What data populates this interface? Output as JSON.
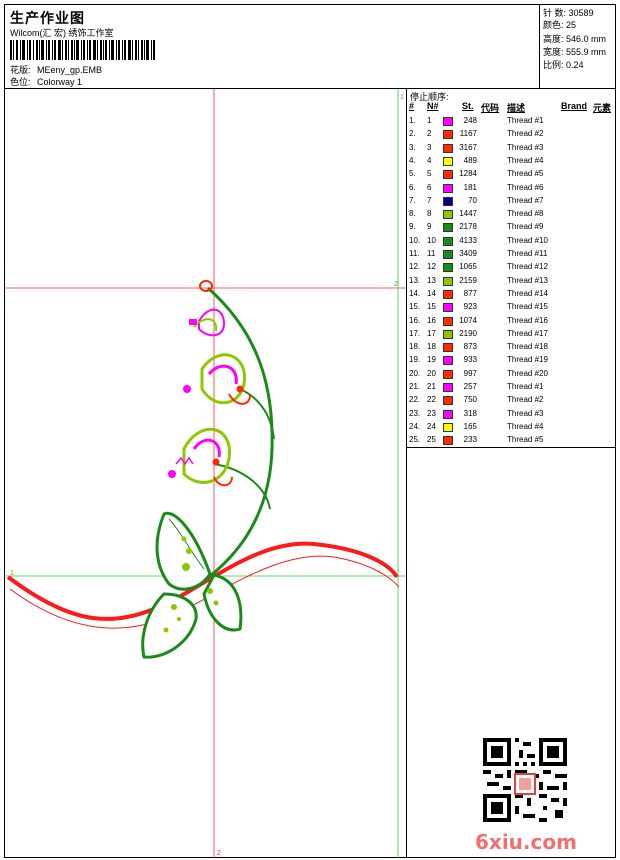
{
  "header": {
    "title": "生产作业图",
    "subtitle": "Wilcom(汇 宏) 绣饰工作室",
    "design_label": "花版:",
    "design_value": "MEeny_gp.EMB",
    "colorway_label": "色位:",
    "colorway_value": "Colorway 1"
  },
  "stats": [
    {
      "label": "针 数:",
      "value": "30589"
    },
    {
      "label": "颜色:",
      "value": "25"
    },
    {
      "label": "高度:",
      "value": "546.0 mm"
    },
    {
      "label": "宽度:",
      "value": "555.9 mm"
    },
    {
      "label": "比例:",
      "value": "0.24"
    }
  ],
  "canvas_marks": {
    "top_right": "1",
    "left_mid": "1",
    "red_right": "2",
    "bottom": "2"
  },
  "stops": {
    "title": "停止顺序:",
    "headers": {
      "num": "#",
      "n": "N#",
      "st": "St.",
      "code": "代码",
      "desc": "描述",
      "brand": "Brand",
      "elements": "元素"
    },
    "rows": [
      {
        "i": "1.",
        "n": "1",
        "st": "248",
        "color": "#ff00ff",
        "desc": "Thread #1"
      },
      {
        "i": "2.",
        "n": "2",
        "st": "1167",
        "color": "#ff2a00",
        "desc": "Thread #2"
      },
      {
        "i": "3.",
        "n": "3",
        "st": "3167",
        "color": "#ff2a00",
        "desc": "Thread #3"
      },
      {
        "i": "4.",
        "n": "4",
        "st": "489",
        "color": "#ffff00",
        "desc": "Thread #4"
      },
      {
        "i": "5.",
        "n": "5",
        "st": "1284",
        "color": "#ff2a00",
        "desc": "Thread #5"
      },
      {
        "i": "6.",
        "n": "6",
        "st": "181",
        "color": "#ff00ff",
        "desc": "Thread #6"
      },
      {
        "i": "7.",
        "n": "7",
        "st": "70",
        "color": "#000080",
        "desc": "Thread #7"
      },
      {
        "i": "8.",
        "n": "8",
        "st": "1447",
        "color": "#8cc800",
        "desc": "Thread #8"
      },
      {
        "i": "9.",
        "n": "9",
        "st": "2178",
        "color": "#1a8a1a",
        "desc": "Thread #9"
      },
      {
        "i": "10.",
        "n": "10",
        "st": "4133",
        "color": "#1a8a1a",
        "desc": "Thread #10"
      },
      {
        "i": "11.",
        "n": "11",
        "st": "3409",
        "color": "#1a8a1a",
        "desc": "Thread #11"
      },
      {
        "i": "12.",
        "n": "12",
        "st": "1065",
        "color": "#1a8a1a",
        "desc": "Thread #12"
      },
      {
        "i": "13.",
        "n": "13",
        "st": "2159",
        "color": "#8cc800",
        "desc": "Thread #13"
      },
      {
        "i": "14.",
        "n": "14",
        "st": "877",
        "color": "#ff2a00",
        "desc": "Thread #14"
      },
      {
        "i": "15.",
        "n": "15",
        "st": "923",
        "color": "#ff00ff",
        "desc": "Thread #15"
      },
      {
        "i": "16.",
        "n": "16",
        "st": "1074",
        "color": "#ff2a00",
        "desc": "Thread #16"
      },
      {
        "i": "17.",
        "n": "17",
        "st": "2190",
        "color": "#8cc800",
        "desc": "Thread #17"
      },
      {
        "i": "18.",
        "n": "18",
        "st": "873",
        "color": "#ff2a00",
        "desc": "Thread #18"
      },
      {
        "i": "19.",
        "n": "19",
        "st": "933",
        "color": "#ff00ff",
        "desc": "Thread #19"
      },
      {
        "i": "20.",
        "n": "20",
        "st": "997",
        "color": "#ff2a00",
        "desc": "Thread #20"
      },
      {
        "i": "21.",
        "n": "21",
        "st": "257",
        "color": "#ff00ff",
        "desc": "Thread #1"
      },
      {
        "i": "22.",
        "n": "22",
        "st": "750",
        "color": "#ff2a00",
        "desc": "Thread #2"
      },
      {
        "i": "23.",
        "n": "23",
        "st": "318",
        "color": "#ff00ff",
        "desc": "Thread #3"
      },
      {
        "i": "24.",
        "n": "24",
        "st": "165",
        "color": "#ffff00",
        "desc": "Thread #4"
      },
      {
        "i": "25.",
        "n": "25",
        "st": "233",
        "color": "#ff2a00",
        "desc": "Thread #5"
      }
    ]
  },
  "watermark": {
    "logo_text": "6xiu.com"
  }
}
